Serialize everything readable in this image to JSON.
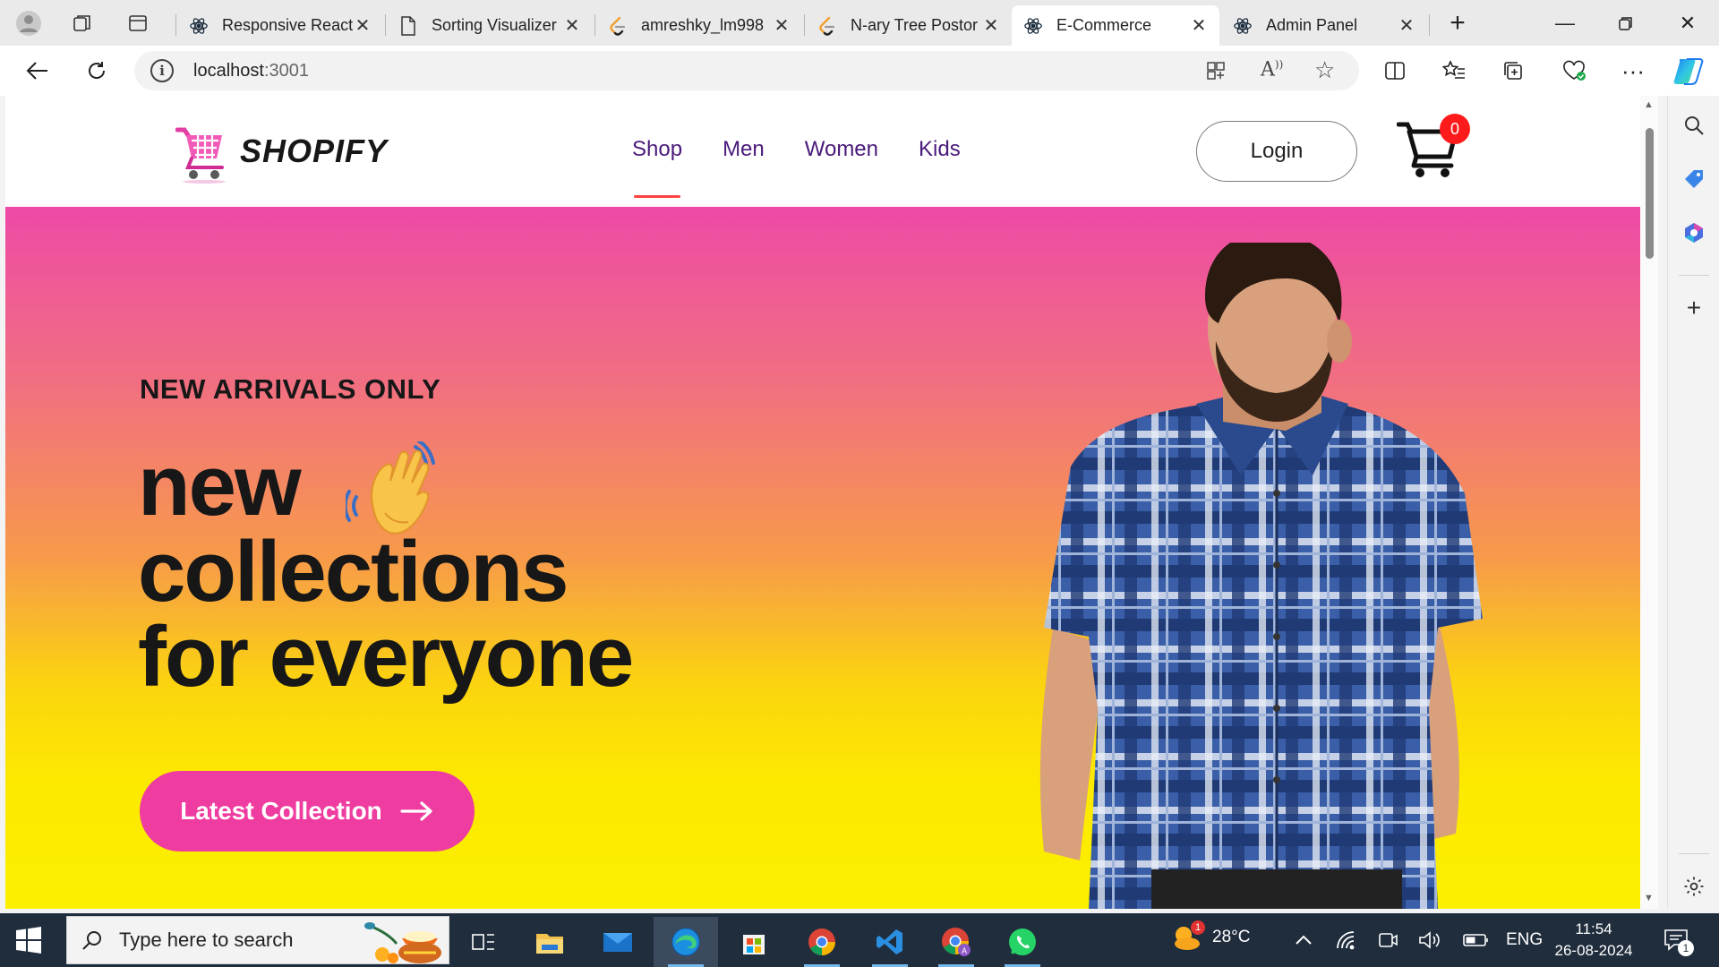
{
  "browser": {
    "tabs": [
      {
        "label": "Responsive React",
        "icon": "react-icon",
        "active": false
      },
      {
        "label": "Sorting Visualizer",
        "icon": "page-icon",
        "active": false
      },
      {
        "label": "amreshky_lm998",
        "icon": "leetcode-icon",
        "active": false
      },
      {
        "label": "N-ary Tree Postor",
        "icon": "leetcode-icon",
        "active": false
      },
      {
        "label": "E-Commerce",
        "icon": "react-icon",
        "active": true
      },
      {
        "label": "Admin Panel",
        "icon": "react-icon",
        "active": false
      }
    ],
    "url_host": "localhost",
    "url_port": ":3001"
  },
  "site": {
    "brand": "SHOPIFY",
    "nav": [
      "Shop",
      "Men",
      "Women",
      "Kids"
    ],
    "active_nav": "Shop",
    "login_label": "Login",
    "cart_count": "0",
    "colors": {
      "accent": "#ff4141",
      "nav_text": "#4a1a7a",
      "cta": "#ef3ca0",
      "gradient_top": "#ee4aa6",
      "gradient_bottom": "#fcf000"
    }
  },
  "hero": {
    "kicker": "NEW ARRIVALS ONLY",
    "line1": "new",
    "line2": "collections",
    "line3": "for everyone",
    "cta_label": "Latest Collection",
    "cta_icon": "arrow-right-icon",
    "wave_icon": "waving-hand-icon",
    "model_image": "man-in-plaid-shirt"
  },
  "taskbar": {
    "search_placeholder": "Type here to search",
    "weather": "28°C",
    "weather_badge": "1",
    "language": "ENG",
    "time": "11:54",
    "date": "26-08-2024",
    "notification_count": "1"
  }
}
